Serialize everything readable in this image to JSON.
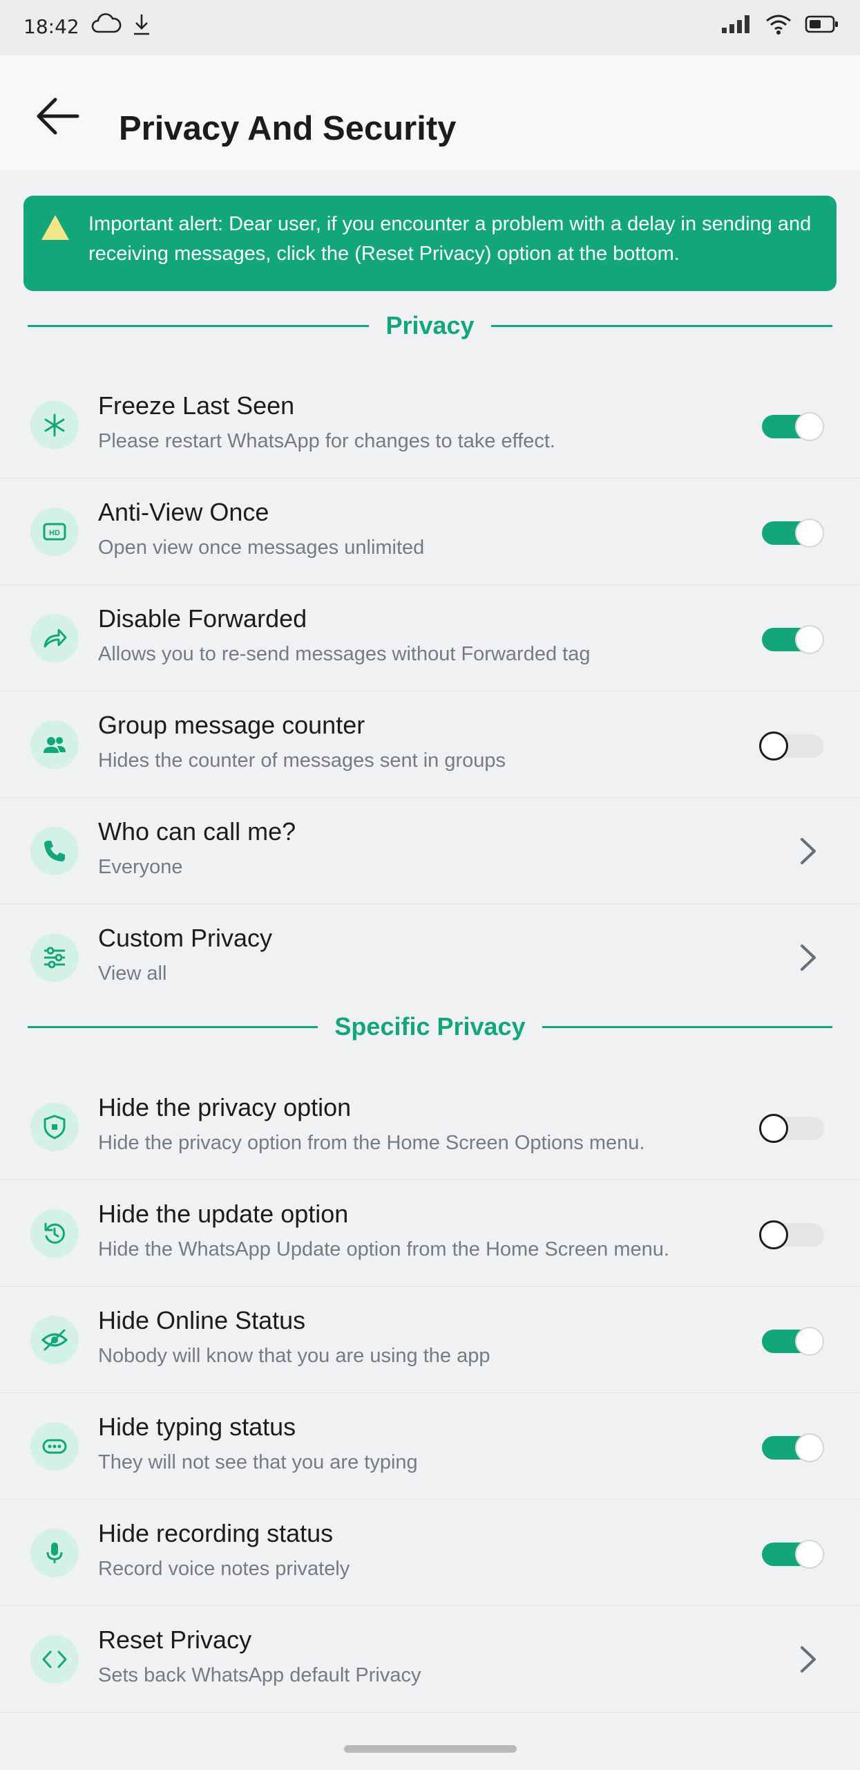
{
  "status_bar": {
    "time": "18:42",
    "left_icons": [
      "cloud-icon",
      "download-icon"
    ],
    "right_icons": [
      "signal-icon",
      "wifi-icon",
      "battery-icon"
    ]
  },
  "header": {
    "title": "Privacy And Security",
    "back_icon": "arrow-left-icon"
  },
  "alert": {
    "icon": "warning-icon",
    "text": "Important alert: Dear user, if you encounter a problem with a delay in sending and receiving messages, click the (Reset Privacy) option at the bottom."
  },
  "sections": {
    "privacy": {
      "label": "Privacy",
      "items": [
        {
          "title": "Freeze Last Seen",
          "subtitle": "Please restart WhatsApp for changes to take effect.",
          "control": "toggle",
          "state": "on",
          "icon": "freeze-icon"
        },
        {
          "title": "Anti-View Once",
          "subtitle": "Open view once messages unlimited",
          "control": "toggle",
          "state": "on",
          "icon": "hd-icon"
        },
        {
          "title": "Disable Forwarded",
          "subtitle": "Allows you to re-send messages without Forwarded tag",
          "control": "toggle",
          "state": "on",
          "icon": "forward-icon"
        },
        {
          "title": "Group message counter",
          "subtitle": "Hides the counter of messages sent in groups",
          "control": "toggle",
          "state": "off",
          "icon": "group-icon"
        },
        {
          "title": "Who can call me?",
          "subtitle": "Everyone",
          "control": "chevron",
          "icon": "phone-icon"
        },
        {
          "title": "Custom Privacy",
          "subtitle": "View all",
          "control": "chevron",
          "icon": "sliders-icon"
        }
      ]
    },
    "specific": {
      "label": "Specific Privacy",
      "items": [
        {
          "title": "Hide the privacy option",
          "subtitle": "Hide the privacy option from the Home Screen Options menu.",
          "control": "toggle",
          "state": "off",
          "icon": "shield-icon"
        },
        {
          "title": "Hide the update option",
          "subtitle": "Hide the WhatsApp Update option from the Home Screen menu.",
          "control": "toggle",
          "state": "off",
          "icon": "refresh-icon"
        },
        {
          "title": "Hide Online Status",
          "subtitle": "Nobody will know that you are using the app",
          "control": "toggle",
          "state": "on",
          "icon": "eye-off-icon"
        },
        {
          "title": "Hide typing status",
          "subtitle": "They will not see that you are typing",
          "control": "toggle",
          "state": "on",
          "icon": "typing-icon"
        },
        {
          "title": "Hide recording status",
          "subtitle": "Record voice notes privately",
          "control": "toggle",
          "state": "on",
          "icon": "microphone-icon"
        },
        {
          "title": "Reset Privacy",
          "subtitle": "Sets back WhatsApp default Privacy",
          "control": "chevron",
          "icon": "code-icon"
        }
      ]
    }
  },
  "colors": {
    "accent": "#12a67a",
    "icon_bg": "#d4f1e6",
    "background": "#f0f1f3"
  }
}
